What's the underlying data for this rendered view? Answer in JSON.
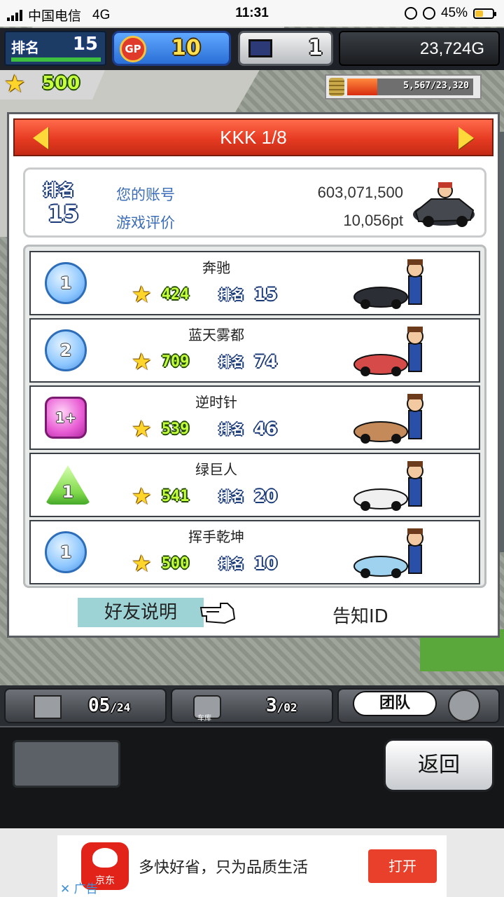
{
  "status_bar": {
    "carrier": "中国电信",
    "network": "4G",
    "time": "11:31",
    "battery_percent": "45%",
    "battery_level": 0.45
  },
  "hud": {
    "rank_label": "排名",
    "rank_value": "15",
    "gp_icon": "GP",
    "gp_value": "10",
    "pc_value": "1",
    "money": "23,724G",
    "stars": "500",
    "progress_text": "5,567/23,320",
    "progress_fraction": 0.239
  },
  "dialog": {
    "title": "KKK 1/8",
    "account": {
      "rank_label": "排名",
      "rank_value": "15",
      "account_label": "您的账号",
      "account_value": "603,071,500",
      "rating_label": "游戏评价",
      "rating_value": "10,056pt"
    },
    "friends": [
      {
        "name": "奔驰",
        "tier": "1",
        "tier_style": "blue",
        "stars": "424",
        "rank_label": "排名",
        "rank": "15"
      },
      {
        "name": "蓝天雾都",
        "tier": "2",
        "tier_style": "blue",
        "stars": "709",
        "rank_label": "排名",
        "rank": "74"
      },
      {
        "name": "逆时针",
        "tier": "1+",
        "tier_style": "pink",
        "stars": "539",
        "rank_label": "排名",
        "rank": "46"
      },
      {
        "name": "绿巨人",
        "tier": "1",
        "tier_style": "green",
        "stars": "541",
        "rank_label": "排名",
        "rank": "20"
      },
      {
        "name": "挥手乾坤",
        "tier": "1",
        "tier_style": "blue",
        "stars": "500",
        "rank_label": "排名",
        "rank": "10"
      }
    ],
    "explain_button": "好友说明",
    "notify_button": "告知ID"
  },
  "bottom_bar": {
    "slot_left": "05",
    "slot_left_max": "/24",
    "garage_label": "车库",
    "slot_right": "3",
    "slot_right_max": "/02",
    "team_label": "团队",
    "back_button": "返回"
  },
  "ad": {
    "brand": "京东",
    "text": "多快好省，只为品质生活",
    "open_button": "打开",
    "tag": "广告",
    "close_icon": "✕"
  },
  "colors": {
    "header_red": "#e63b22",
    "label_blue": "#3c6db7",
    "explain_bg": "#9ed3d6",
    "ad_button": "#e8402a"
  }
}
